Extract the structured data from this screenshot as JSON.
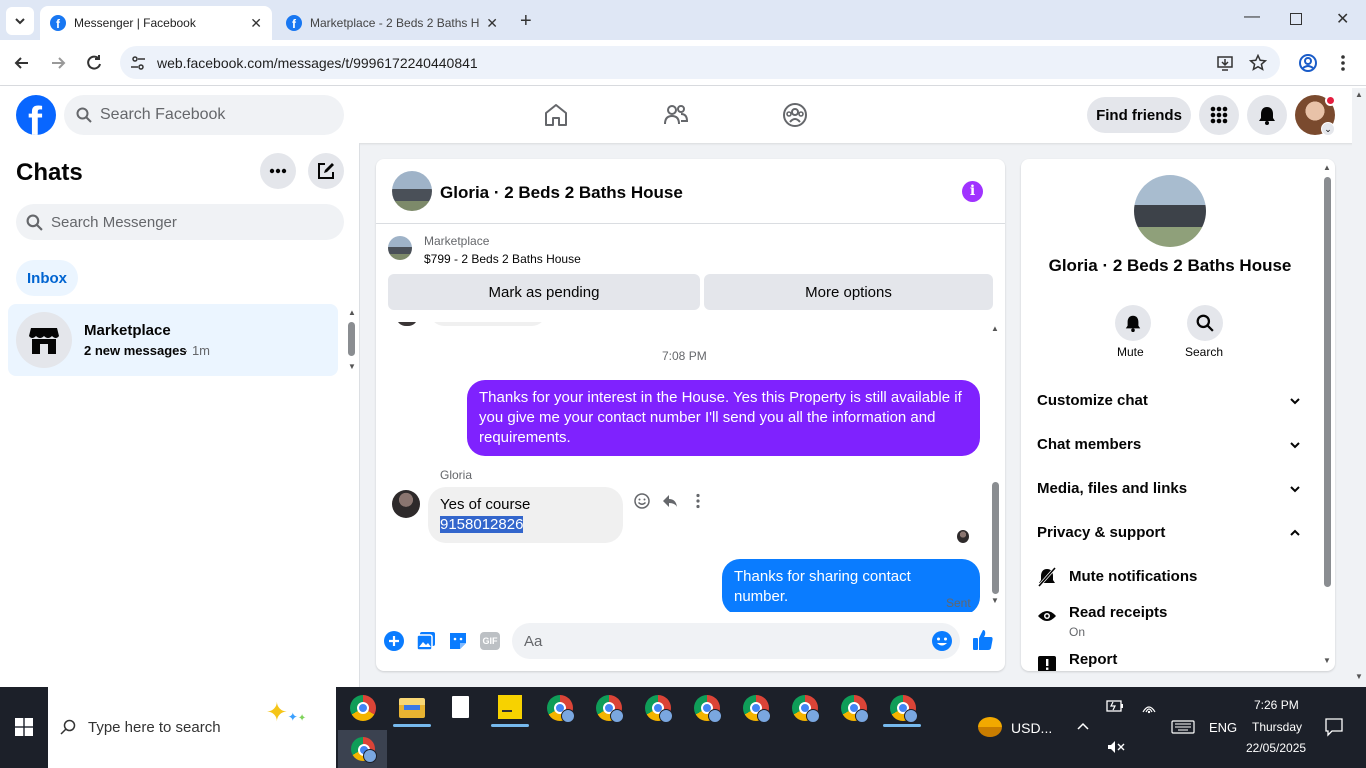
{
  "browser": {
    "tabs": [
      {
        "title": "Messenger | Facebook",
        "active": true
      },
      {
        "title": "Marketplace - 2 Beds 2 Baths H",
        "active": false
      }
    ],
    "url": "web.facebook.com/messages/t/9996172240440841"
  },
  "header": {
    "search_placeholder": "Search Facebook",
    "find_friends": "Find friends"
  },
  "sidebar": {
    "title": "Chats",
    "search_placeholder": "Search Messenger",
    "inbox_label": "Inbox",
    "chats": [
      {
        "name": "Marketplace",
        "preview": "2 new messages",
        "time": "· 1m"
      }
    ]
  },
  "chat": {
    "title": "Gloria · 2 Beds 2 Baths House",
    "listing": {
      "source": "Marketplace",
      "title": "$799 - 2 Beds 2 Baths House"
    },
    "mark_pending": "Mark as pending",
    "more_options": "More options",
    "timestamp": "7:08 PM",
    "messages": [
      {
        "from": "me",
        "text": "Thanks for your interest in the House. Yes this Property is still available if you give me your contact number I'll send you all the information and requirements."
      },
      {
        "from": "Gloria",
        "text_prefix": "Yes of course ",
        "text_selected": "9158012826"
      },
      {
        "from": "me",
        "text": "Thanks for sharing contact number.",
        "status": "Sent"
      }
    ],
    "composer_placeholder": "Aa",
    "gif_label": "GIF",
    "accent": "#7f22fe"
  },
  "info_panel": {
    "title": "Gloria · 2 Beds 2 Baths House",
    "mute_label": "Mute",
    "search_label": "Search",
    "sections": [
      "Customize chat",
      "Chat members",
      "Media, files and links",
      "Privacy & support"
    ],
    "privacy_items": [
      {
        "label": "Mute notifications",
        "sub": ""
      },
      {
        "label": "Read receipts",
        "sub": "On"
      },
      {
        "label": "Report",
        "sub": ""
      }
    ]
  },
  "taskbar": {
    "search_placeholder": "Type here to search",
    "currency": "USD...",
    "language": "ENG",
    "time": "7:26 PM",
    "day": "Thursday",
    "date": "22/05/2025"
  }
}
